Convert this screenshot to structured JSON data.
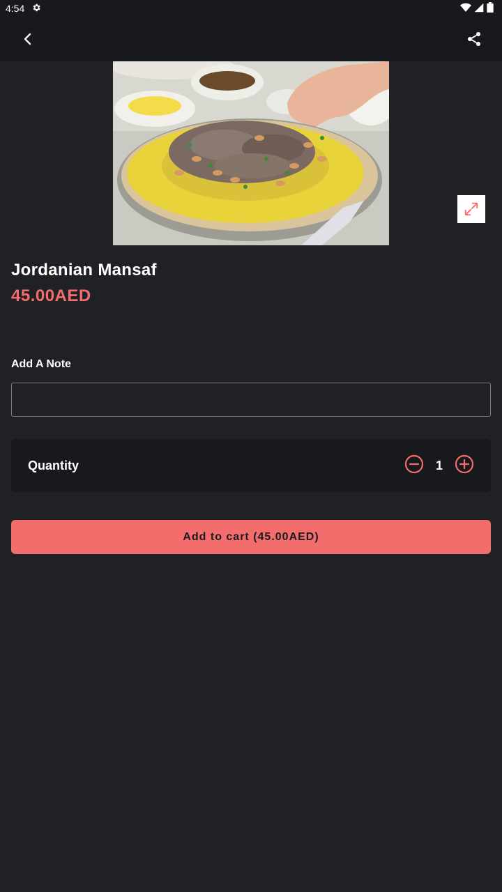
{
  "status_bar": {
    "time": "4:54"
  },
  "product": {
    "name": "Jordanian Mansaf",
    "price": "45.00AED"
  },
  "note": {
    "label": "Add A Note",
    "value": "",
    "placeholder": ""
  },
  "quantity": {
    "label": "Quantity",
    "value": "1"
  },
  "cart_button": {
    "label": "Add to cart (45.00AED)"
  },
  "colors": {
    "accent": "#f46d6d",
    "background": "#202125",
    "surface": "#18191c"
  },
  "icons": [
    "gear-icon",
    "wifi-icon",
    "signal-icon",
    "battery-icon",
    "back-arrow-icon",
    "share-icon",
    "expand-icon",
    "minus-circle-icon",
    "plus-circle-icon"
  ]
}
